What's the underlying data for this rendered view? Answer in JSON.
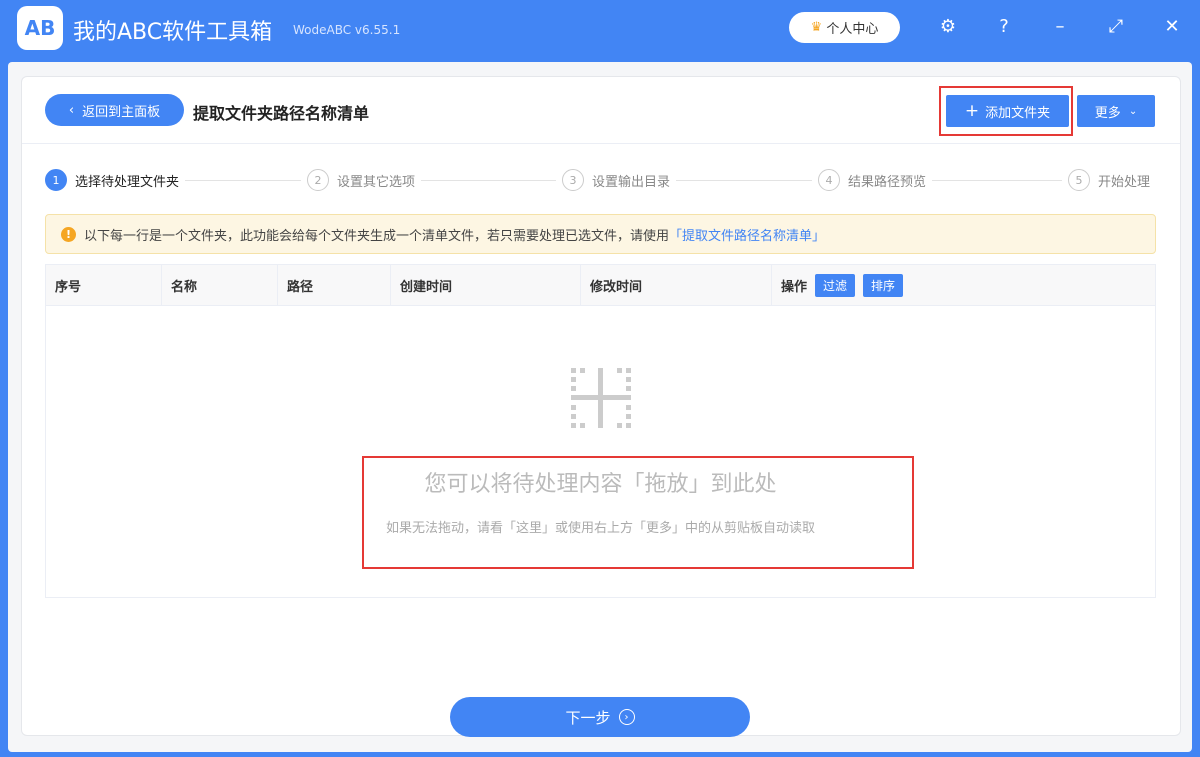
{
  "app": {
    "logo": "AB",
    "title": "我的ABC软件工具箱",
    "version": "WodeABC v6.55.1",
    "user_center": "个人中心"
  },
  "header": {
    "back": "返回到主面板",
    "title": "提取文件夹路径名称清单",
    "add_folder": "添加文件夹",
    "more": "更多"
  },
  "steps": [
    {
      "n": "1",
      "label": "选择待处理文件夹"
    },
    {
      "n": "2",
      "label": "设置其它选项"
    },
    {
      "n": "3",
      "label": "设置输出目录"
    },
    {
      "n": "4",
      "label": "结果路径预览"
    },
    {
      "n": "5",
      "label": "开始处理"
    }
  ],
  "notice": {
    "text": "以下每一行是一个文件夹，此功能会给每个文件夹生成一个清单文件，若只需要处理已选文件，请使用",
    "link": "「提取文件路径名称清单」"
  },
  "table": {
    "columns": [
      "序号",
      "名称",
      "路径",
      "创建时间",
      "修改时间",
      "操作"
    ],
    "filter": "过滤",
    "sort": "排序"
  },
  "empty": {
    "main": "您可以将待处理内容「拖放」到此处",
    "sub": "如果无法拖动，请看「这里」或使用右上方「更多」中的从剪贴板自动读取"
  },
  "footer": {
    "next": "下一步"
  }
}
